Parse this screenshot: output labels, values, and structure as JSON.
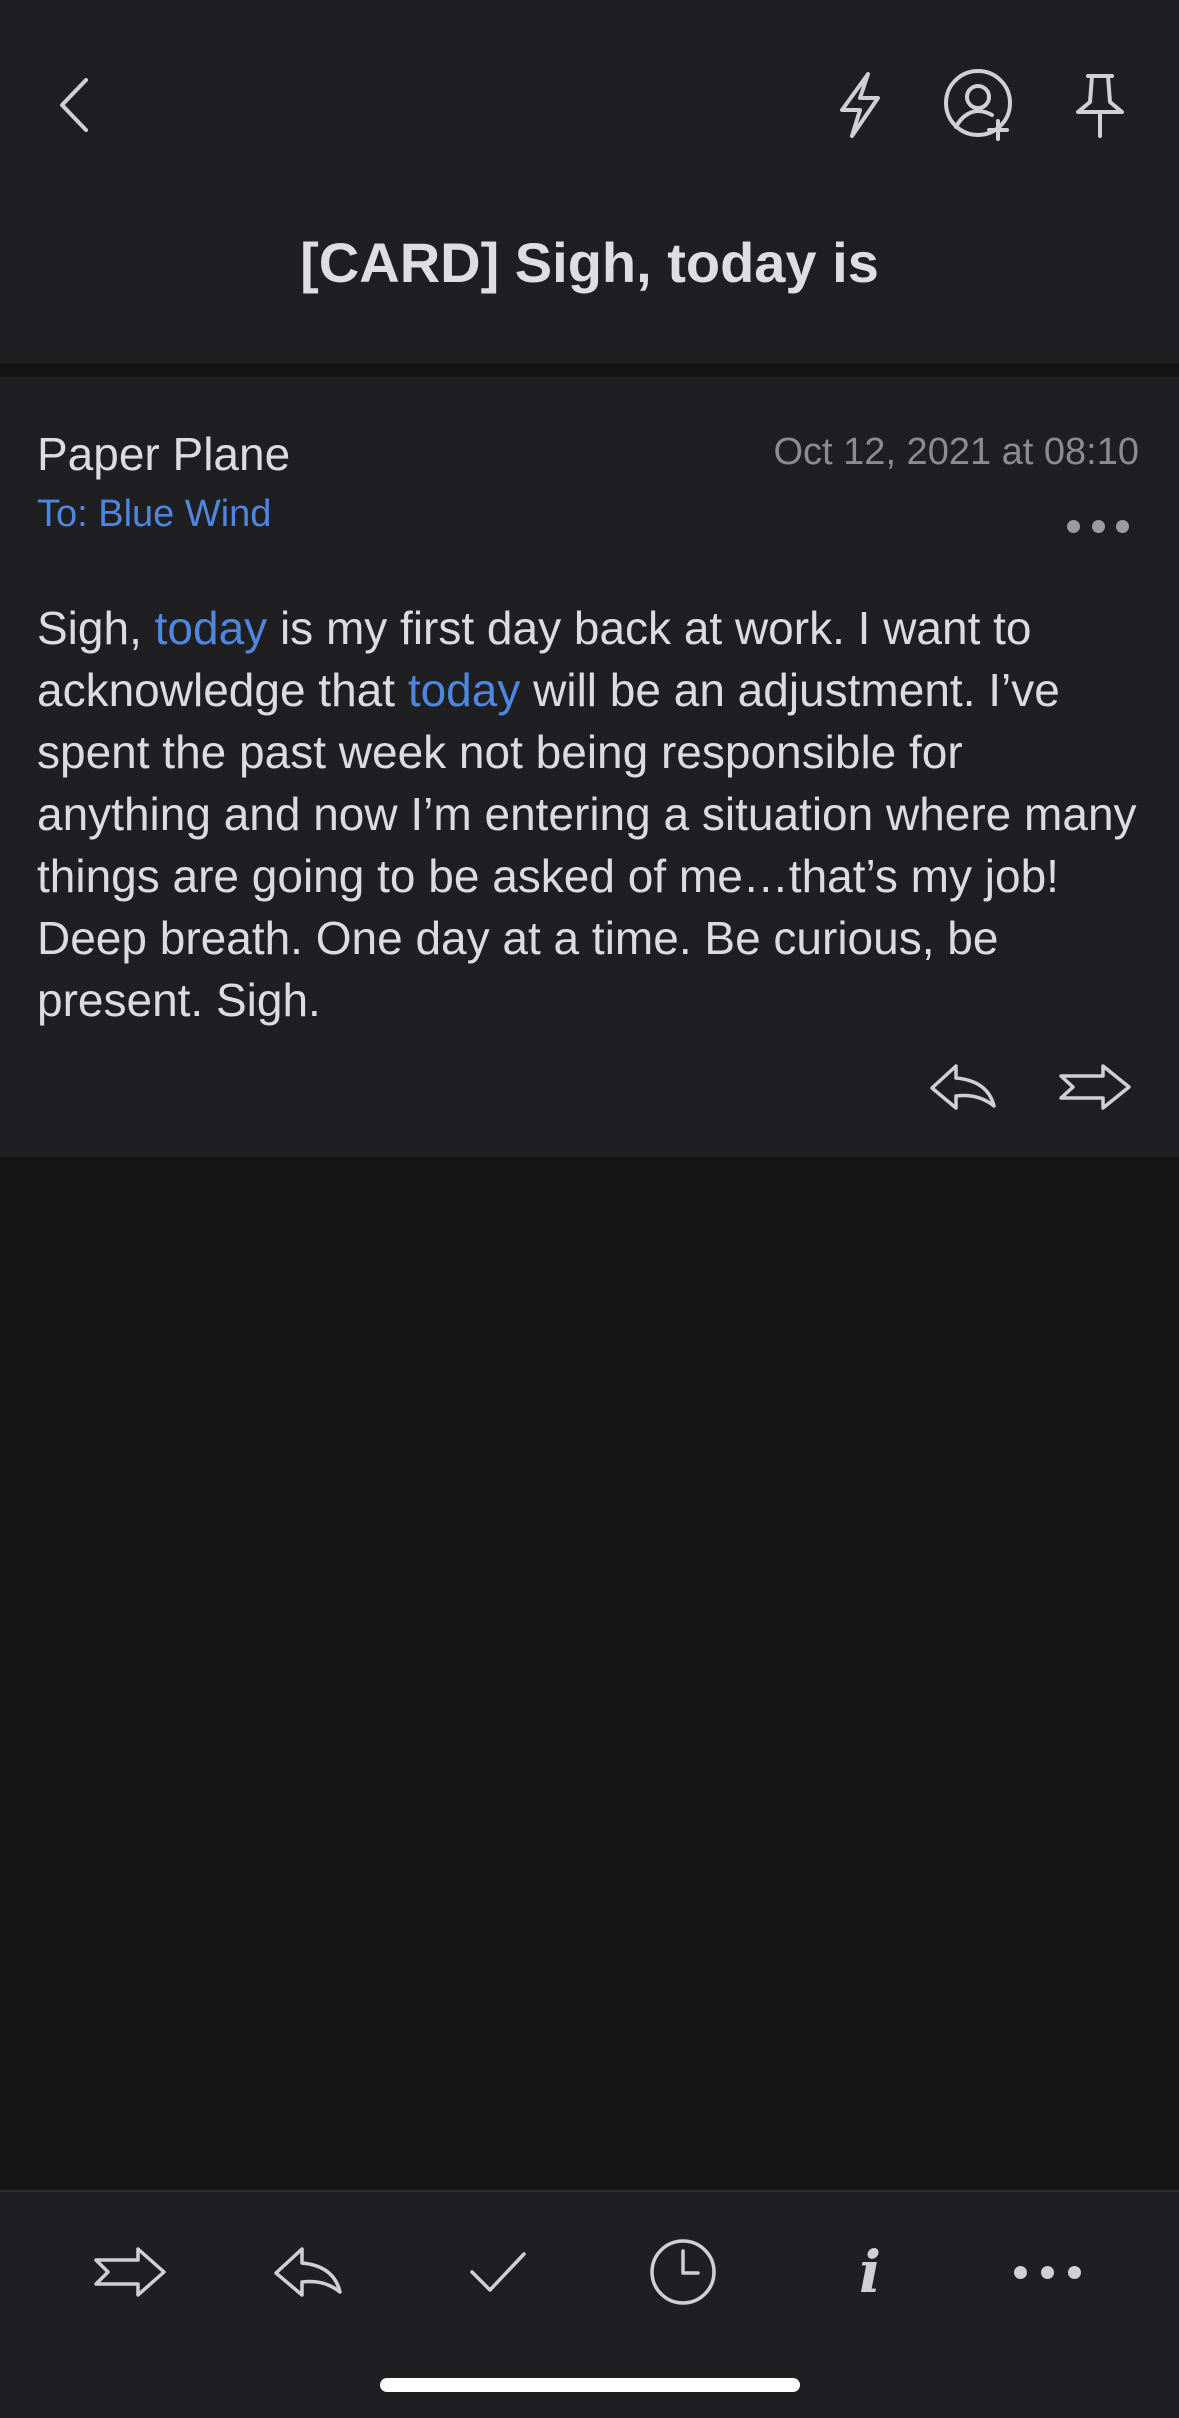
{
  "header": {
    "title": "[CARD] Sigh, today is",
    "icons": [
      "back-chevron-icon",
      "lightning-bolt-icon",
      "add-contact-icon",
      "pin-icon"
    ]
  },
  "message": {
    "sender": "Paper Plane",
    "date": "Oct 12, 2021 at 08:10",
    "to": "To: Blue Wind",
    "body_parts": [
      {
        "text": "Sigh, ",
        "highlight": false
      },
      {
        "text": "today",
        "highlight": true
      },
      {
        "text": " is my first day back at work. I want to acknowledge that ",
        "highlight": false
      },
      {
        "text": "today",
        "highlight": true
      },
      {
        "text": " will be an adjustment. I’ve spent the past week not being responsible for anything and now I’m entering a situation where many things are going to be asked of me…that’s my job! Deep breath. One day at a time. Be curious, be present. Sigh.",
        "highlight": false
      }
    ],
    "actions": [
      "reply-icon",
      "forward-icon"
    ]
  },
  "toolbar": {
    "items": [
      "forward-icon",
      "reply-icon",
      "checkmark-icon",
      "clock-icon",
      "info-icon",
      "more-icon"
    ],
    "info_label": "i"
  },
  "colors": {
    "background": "#151515",
    "surface": "#1f1f21",
    "accent": "#4f86de",
    "text": "#dcdce0",
    "muted": "#8b8b90"
  }
}
